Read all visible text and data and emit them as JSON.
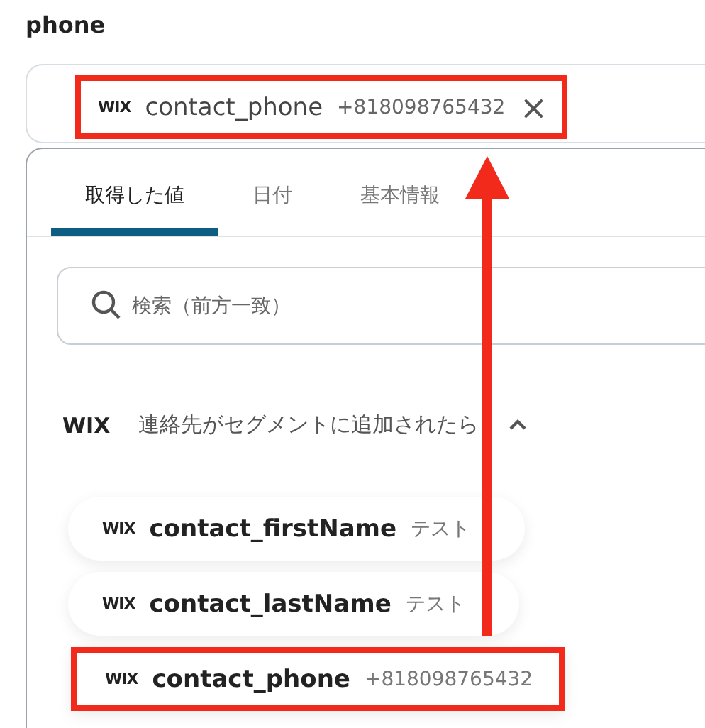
{
  "field": {
    "label": "phone",
    "chip": {
      "source": "WIX",
      "name": "contact_phone",
      "value": "+818098765432",
      "close": "×",
      "highlighted": true
    }
  },
  "tabs": [
    {
      "label": "取得した値",
      "selected": true
    },
    {
      "label": "日付",
      "selected": false
    },
    {
      "label": "基本情報",
      "selected": false
    }
  ],
  "search": {
    "placeholder": "検索（前方一致）"
  },
  "section": {
    "source": "WIX",
    "title": "連絡先がセグメントに追加されたら",
    "expanded": true
  },
  "items": [
    {
      "source": "WIX",
      "name": "contact_firstName",
      "value": "テスト",
      "highlighted": false
    },
    {
      "source": "WIX",
      "name": "contact_lastName",
      "value": "テスト",
      "highlighted": false
    },
    {
      "source": "WIX",
      "name": "contact_phone",
      "value": "+818098765432",
      "highlighted": true
    }
  ],
  "annotation": {
    "arrow": true
  }
}
